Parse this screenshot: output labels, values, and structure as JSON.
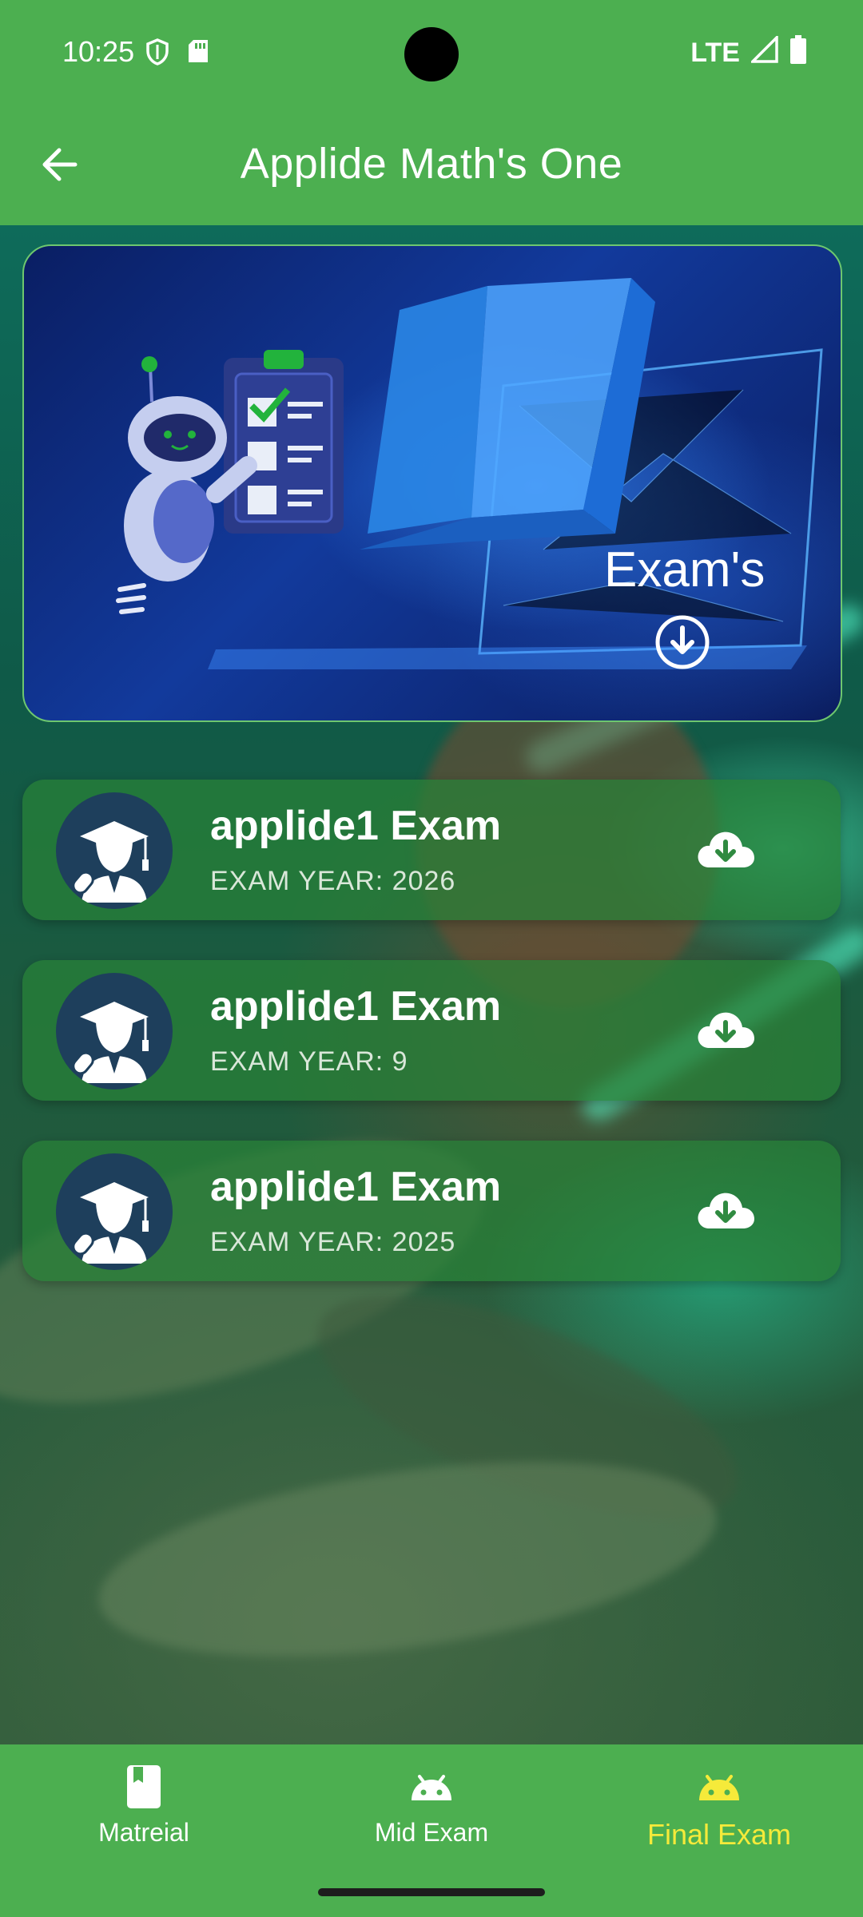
{
  "status_bar": {
    "time": "10:25",
    "network": "LTE",
    "icons": [
      "shield-icon",
      "sd-card-icon",
      "signal-icon",
      "battery-icon"
    ]
  },
  "app_bar": {
    "title": "Applide Math's One",
    "back_icon": "arrow-left-icon"
  },
  "banner": {
    "label": "Exam's",
    "icon": "download-circle-icon"
  },
  "exams": [
    {
      "title": "applide1 Exam",
      "year": "EXAM YEAR: 2026",
      "icon": "cloud-download-icon"
    },
    {
      "title": "applide1 Exam",
      "year": "EXAM YEAR: 9",
      "icon": "cloud-download-icon"
    },
    {
      "title": "applide1 Exam",
      "year": "EXAM YEAR: 2025",
      "icon": "cloud-download-icon"
    }
  ],
  "bottom_nav": {
    "items": [
      {
        "label": "Matreial",
        "icon": "book-icon",
        "active": false
      },
      {
        "label": "Mid Exam",
        "icon": "android-icon",
        "active": false
      },
      {
        "label": "Final Exam",
        "icon": "android-icon",
        "active": true
      }
    ]
  },
  "colors": {
    "primary": "#4caf50",
    "active_nav": "#f5ea3a",
    "card": "#28823a",
    "avatar_bg": "#1e3f5c"
  }
}
